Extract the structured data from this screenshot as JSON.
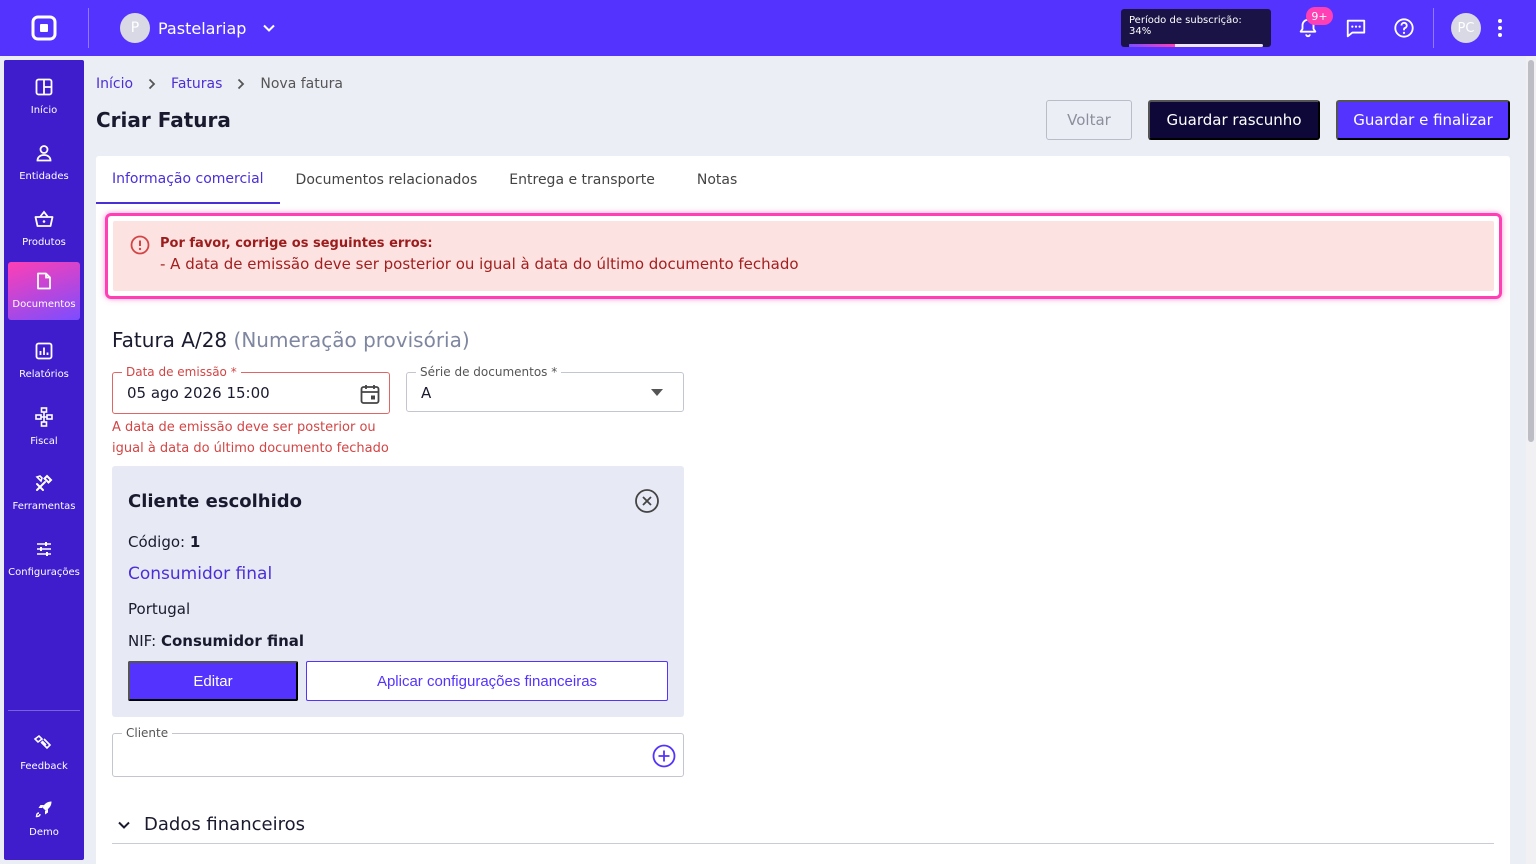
{
  "topbar": {
    "company_initial": "P",
    "company_name": "Pastelariap",
    "subscription_label": "Período de subscrição: 34%",
    "subscription_progress": 0.34,
    "notifications_badge": "9+",
    "user_initials": "PC"
  },
  "sidebar": {
    "items": [
      {
        "label": "Início",
        "icon": "grid-icon"
      },
      {
        "label": "Entidades",
        "icon": "person-icon"
      },
      {
        "label": "Produtos",
        "icon": "basket-icon"
      },
      {
        "label": "Documentos",
        "icon": "document-icon",
        "active": true
      },
      {
        "label": "Relatórios",
        "icon": "chart-icon"
      },
      {
        "label": "Fiscal",
        "icon": "hierarchy-icon"
      },
      {
        "label": "Ferramentas",
        "icon": "tools-icon"
      },
      {
        "label": "Configurações",
        "icon": "sliders-icon"
      }
    ],
    "bottom": [
      {
        "label": "Feedback",
        "icon": "feedback-icon"
      },
      {
        "label": "Demo",
        "icon": "rocket-icon"
      }
    ]
  },
  "breadcrumb": {
    "home": "Início",
    "section": "Faturas",
    "current": "Nova fatura"
  },
  "header": {
    "title": "Criar Fatura",
    "back_label": "Voltar",
    "draft_label": "Guardar rascunho",
    "finalize_label": "Guardar e finalizar"
  },
  "tabs": [
    {
      "label": "Informação comercial",
      "active": true
    },
    {
      "label": "Documentos relacionados"
    },
    {
      "label": "Entrega e transporte"
    },
    {
      "label": "Notas"
    }
  ],
  "alert": {
    "title": "Por favor, corrige os seguintes erros:",
    "message": "- A data de emissão deve ser posterior ou igual à data do último documento fechado"
  },
  "document": {
    "title": "Fatura A/28",
    "provisional": "(Numeração provisória)"
  },
  "form": {
    "date_label": "Data de emissão *",
    "date_value": "05 ago 2026 15:00",
    "date_error": "A data de emissão deve ser posterior ou igual à data do último documento fechado",
    "series_label": "Série de documentos *",
    "series_value": "A",
    "client_label": "Cliente"
  },
  "client": {
    "title": "Cliente escolhido",
    "code_label": "Código:",
    "code_value": "1",
    "name": "Consumidor final",
    "country": "Portugal",
    "nif_label": "NIF:",
    "nif_value": "Consumidor final",
    "edit_label": "Editar",
    "apply_label": "Aplicar configurações financeiras"
  },
  "sections": {
    "financial": "Dados financeiros"
  },
  "colors": {
    "brand": "#5533ff",
    "sidebar": "#3f1dcc",
    "error": "#d34545",
    "alert_border": "#ff3fb4"
  }
}
